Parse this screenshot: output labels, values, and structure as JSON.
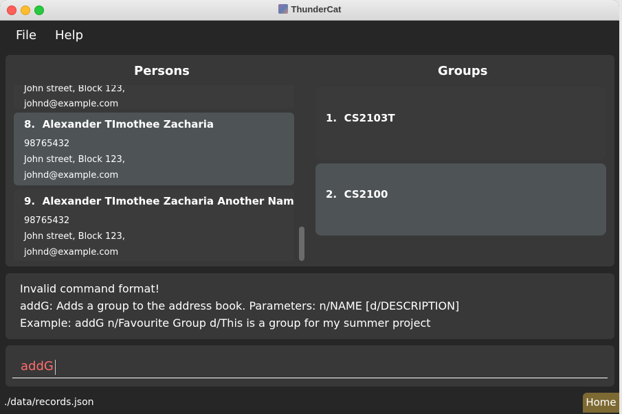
{
  "window": {
    "title": "ThunderCat"
  },
  "menu": {
    "file": "File",
    "help": "Help"
  },
  "persons": {
    "title": "Persons",
    "clipped_top": {
      "address": "John street, Block 123,",
      "email": "johnd@example.com"
    },
    "items": [
      {
        "index": "8.",
        "name": "Alexander TImothee Zacharia",
        "phone": "98765432",
        "address": "John street, Block 123,",
        "email": "johnd@example.com"
      },
      {
        "index": "9.",
        "name": "Alexander TImothee Zacharia Another Name ...",
        "phone": "98765432",
        "address": "John street, Block 123,",
        "email": "johnd@example.com"
      }
    ]
  },
  "groups": {
    "title": "Groups",
    "items": [
      {
        "index": "1.",
        "name": "CS2103T"
      },
      {
        "index": "2.",
        "name": "CS2100"
      }
    ]
  },
  "result": {
    "line1": "Invalid command format!",
    "line2": "addG: Adds a group to the address book. Parameters: n/NAME [d/DESCRIPTION]",
    "line3": "Example: addG n/Favourite Group d/This is a group for my summer project"
  },
  "command": {
    "value": "addG"
  },
  "status": {
    "path": "./data/records.json",
    "home": "Home"
  },
  "colors": {
    "command_text": "#ff6d6d",
    "home_button": "#7d6a33",
    "selected_card": "#4e5356"
  }
}
